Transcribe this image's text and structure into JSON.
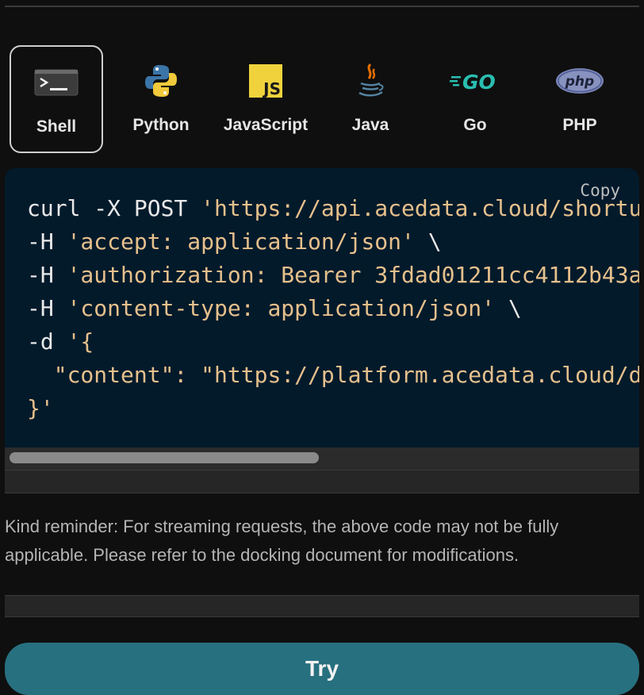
{
  "tabs": [
    {
      "label": "Shell",
      "icon": "terminal-icon",
      "active": true
    },
    {
      "label": "Python",
      "icon": "python-icon",
      "active": false
    },
    {
      "label": "JavaScript",
      "icon": "javascript-icon",
      "active": false
    },
    {
      "label": "Java",
      "icon": "java-icon",
      "active": false
    },
    {
      "label": "Go",
      "icon": "go-icon",
      "active": false
    },
    {
      "label": "PHP",
      "icon": "php-icon",
      "active": false
    }
  ],
  "code": {
    "copy_label": "Copy",
    "lines": [
      {
        "plain": "curl -X POST ",
        "str": "'https://api.acedata.cloud/shortu"
      },
      {
        "plain": "-H ",
        "str": "'accept: application/json'",
        "tail": " \\"
      },
      {
        "plain": "-H ",
        "str": "'authorization: Bearer 3fdad01211cc4112b43a"
      },
      {
        "plain": "-H ",
        "str": "'content-type: application/json'",
        "tail": " \\"
      },
      {
        "plain": "-d ",
        "str": "'{"
      },
      {
        "plain": "  ",
        "str": "\"content\": \"https://platform.acedata.cloud/d"
      },
      {
        "plain": "",
        "str": "}'"
      }
    ]
  },
  "reminder": "Kind reminder: For streaming requests, the above code may not be fully applicable. Please refer to the docking document for modifications.",
  "try_label": "Try",
  "colors": {
    "code_bg": "#031a2b",
    "string": "#e6c08c",
    "try_button": "#27707f"
  }
}
